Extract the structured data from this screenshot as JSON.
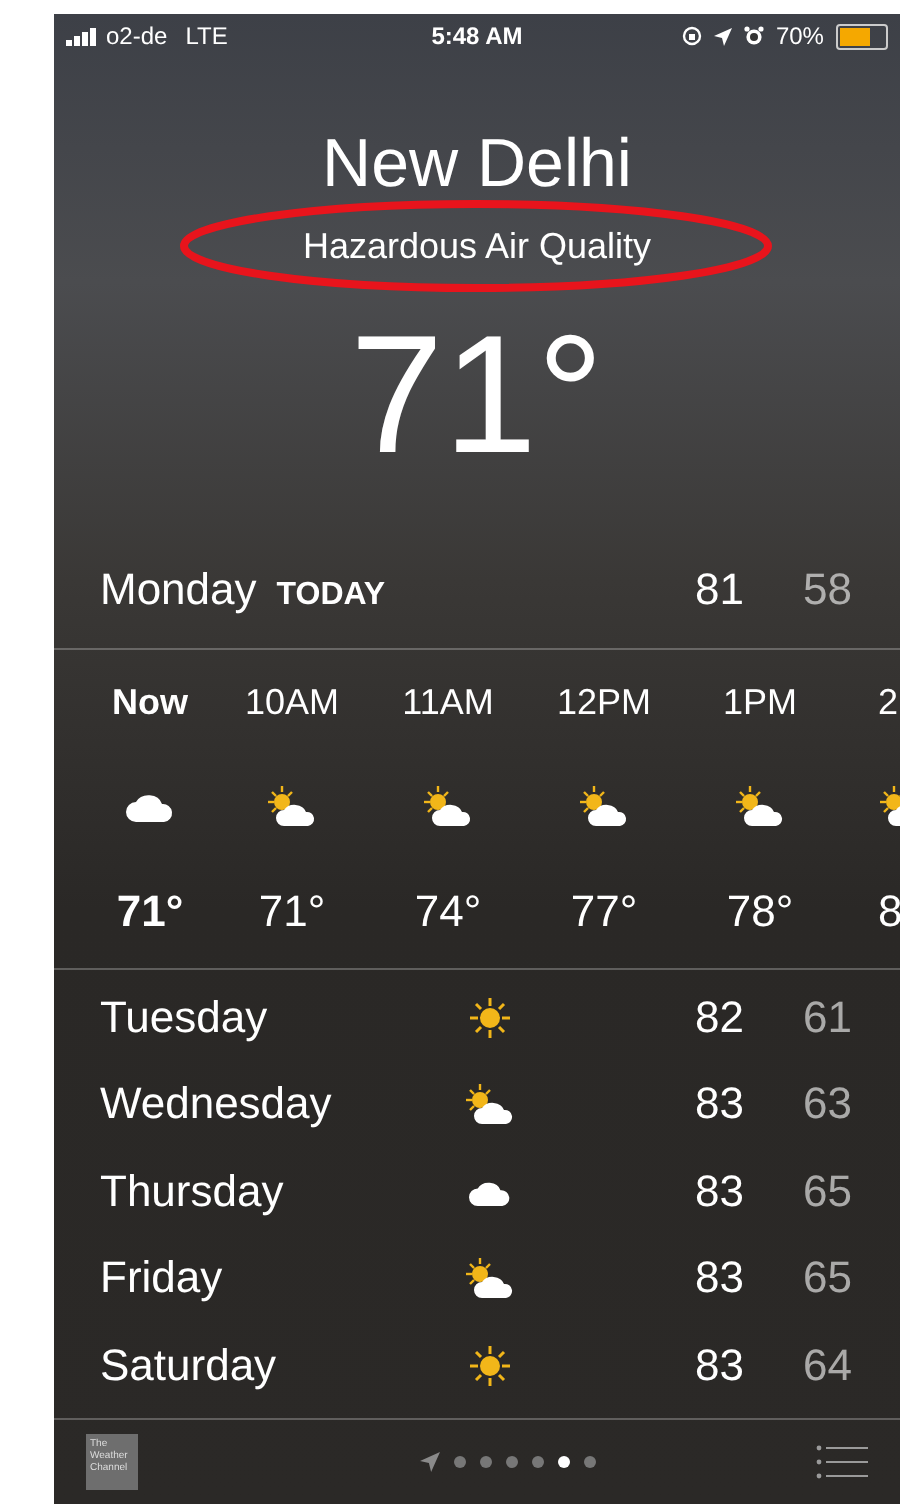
{
  "status_bar": {
    "carrier": "o2-de",
    "network": "LTE",
    "time": "5:48 AM",
    "battery": "70%"
  },
  "header": {
    "city": "New Delhi",
    "condition": "Hazardous Air Quality",
    "temperature": "71°"
  },
  "today": {
    "day": "Monday",
    "label": "TODAY",
    "high": "81",
    "low": "58"
  },
  "hourly": [
    {
      "time": "Now",
      "kind": "cloud",
      "temp": "71°",
      "now": true
    },
    {
      "time": "10AM",
      "kind": "partly-sunny",
      "temp": "71°",
      "now": false
    },
    {
      "time": "11AM",
      "kind": "partly-sunny",
      "temp": "74°",
      "now": false
    },
    {
      "time": "12PM",
      "kind": "partly-sunny",
      "temp": "77°",
      "now": false
    },
    {
      "time": "1PM",
      "kind": "partly-sunny",
      "temp": "78°",
      "now": false
    },
    {
      "time": "2",
      "kind": "partly-sunny",
      "temp": "8",
      "now": false
    }
  ],
  "daily": [
    {
      "day": "Tuesday",
      "kind": "sunny",
      "high": "82",
      "low": "61"
    },
    {
      "day": "Wednesday",
      "kind": "partly-sunny",
      "high": "83",
      "low": "63"
    },
    {
      "day": "Thursday",
      "kind": "cloud",
      "high": "83",
      "low": "65"
    },
    {
      "day": "Friday",
      "kind": "partly-sunny",
      "high": "83",
      "low": "65"
    },
    {
      "day": "Saturday",
      "kind": "sunny",
      "high": "83",
      "low": "64"
    }
  ],
  "bottom_bar": {
    "logo": "The Weather Channel",
    "pages": [
      {
        "selected": false
      },
      {
        "selected": false
      },
      {
        "selected": false
      },
      {
        "selected": false
      },
      {
        "selected": true
      },
      {
        "selected": false
      }
    ]
  }
}
